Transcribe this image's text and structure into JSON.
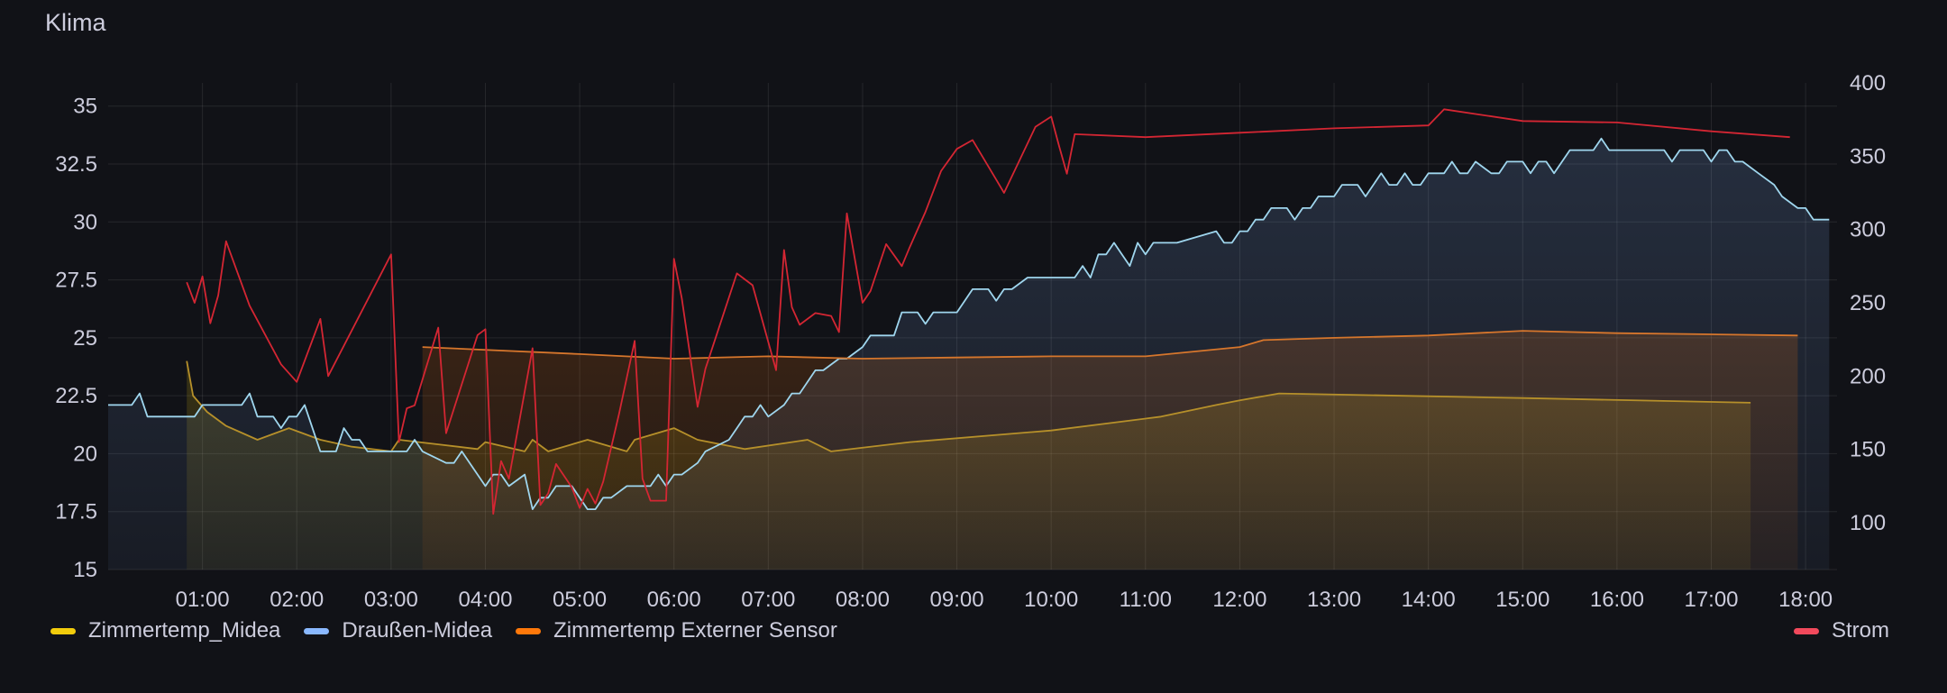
{
  "panel": {
    "title": "Klima"
  },
  "chart_data": {
    "type": "line",
    "x_axis": {
      "type": "time",
      "range": [
        "00:00",
        "18:20"
      ],
      "ticks": [
        "01:00",
        "02:00",
        "03:00",
        "04:00",
        "05:00",
        "06:00",
        "07:00",
        "08:00",
        "09:00",
        "10:00",
        "11:00",
        "12:00",
        "13:00",
        "14:00",
        "15:00",
        "16:00",
        "17:00",
        "18:00"
      ]
    },
    "y_left": {
      "ylim": [
        15,
        36
      ],
      "ticks": [
        15,
        17.5,
        20,
        22.5,
        25,
        27.5,
        30,
        32.5,
        35
      ],
      "tick_labels": [
        "15",
        "17.5",
        "20",
        "22.5",
        "25",
        "27.5",
        "30",
        "32.5",
        "35"
      ]
    },
    "y_right": {
      "ylim": [
        68,
        400
      ],
      "ticks": [
        100,
        150,
        200,
        250,
        300,
        350,
        400
      ],
      "tick_labels": [
        "100",
        "150",
        "200",
        "250",
        "300",
        "350",
        "400"
      ]
    },
    "grid": true,
    "series": [
      {
        "name": "Zimmertemp_Midea",
        "axis": "left",
        "color": "#F2CC0C",
        "stroke": "#b6902a",
        "fill": true,
        "points": [
          [
            "00:50",
            24
          ],
          [
            "00:54",
            22.5
          ],
          [
            "01:03",
            21.8
          ],
          [
            "01:15",
            21.2
          ],
          [
            "01:35",
            20.6
          ],
          [
            "01:55",
            21.1
          ],
          [
            "02:15",
            20.6
          ],
          [
            "02:35",
            20.3
          ],
          [
            "03:00",
            20.1
          ],
          [
            "03:05",
            20.6
          ],
          [
            "03:30",
            20.4
          ],
          [
            "03:55",
            20.2
          ],
          [
            "04:00",
            20.5
          ],
          [
            "04:25",
            20.1
          ],
          [
            "04:30",
            20.6
          ],
          [
            "04:40",
            20.1
          ],
          [
            "05:05",
            20.6
          ],
          [
            "05:30",
            20.1
          ],
          [
            "05:35",
            20.6
          ],
          [
            "06:00",
            21.1
          ],
          [
            "06:15",
            20.6
          ],
          [
            "06:45",
            20.2
          ],
          [
            "07:15",
            20.5
          ],
          [
            "07:25",
            20.6
          ],
          [
            "07:40",
            20.1
          ],
          [
            "08:30",
            20.5
          ],
          [
            "10:00",
            21
          ],
          [
            "11:10",
            21.6
          ],
          [
            "11:45",
            22.1
          ],
          [
            "12:00",
            22.3
          ],
          [
            "12:25",
            22.6
          ],
          [
            "15:00",
            22.4
          ],
          [
            "17:25",
            22.2
          ]
        ]
      },
      {
        "name": "Draußen-Midea",
        "axis": "left",
        "color": "#8AB8FF",
        "stroke": "#9fd6ee",
        "fill": true,
        "points": [
          [
            "00:00",
            22.1
          ],
          [
            "00:15",
            22.1
          ],
          [
            "00:20",
            22.6
          ],
          [
            "00:25",
            21.6
          ],
          [
            "00:55",
            21.6
          ],
          [
            "01:00",
            22.1
          ],
          [
            "01:25",
            22.1
          ],
          [
            "01:30",
            22.6
          ],
          [
            "01:35",
            21.6
          ],
          [
            "01:45",
            21.6
          ],
          [
            "01:50",
            21.1
          ],
          [
            "01:55",
            21.6
          ],
          [
            "02:00",
            21.6
          ],
          [
            "02:05",
            22.1
          ],
          [
            "02:15",
            20.1
          ],
          [
            "02:25",
            20.1
          ],
          [
            "02:30",
            21.1
          ],
          [
            "02:35",
            20.6
          ],
          [
            "02:40",
            20.6
          ],
          [
            "02:45",
            20.1
          ],
          [
            "03:05",
            20.1
          ],
          [
            "03:10",
            20.1
          ],
          [
            "03:15",
            20.6
          ],
          [
            "03:20",
            20.1
          ],
          [
            "03:35",
            19.6
          ],
          [
            "03:40",
            19.6
          ],
          [
            "03:45",
            20.1
          ],
          [
            "04:00",
            18.6
          ],
          [
            "04:05",
            19.1
          ],
          [
            "04:10",
            19.1
          ],
          [
            "04:15",
            18.6
          ],
          [
            "04:25",
            19.1
          ],
          [
            "04:30",
            17.6
          ],
          [
            "04:35",
            18.1
          ],
          [
            "04:40",
            18.1
          ],
          [
            "04:45",
            18.6
          ],
          [
            "04:55",
            18.6
          ],
          [
            "05:00",
            18.1
          ],
          [
            "05:05",
            17.6
          ],
          [
            "05:10",
            17.6
          ],
          [
            "05:15",
            18.1
          ],
          [
            "05:20",
            18.1
          ],
          [
            "05:30",
            18.6
          ],
          [
            "05:35",
            18.6
          ],
          [
            "05:45",
            18.6
          ],
          [
            "05:50",
            19.1
          ],
          [
            "05:55",
            18.6
          ],
          [
            "06:00",
            19.1
          ],
          [
            "06:05",
            19.1
          ],
          [
            "06:15",
            19.6
          ],
          [
            "06:20",
            20.1
          ],
          [
            "06:35",
            20.6
          ],
          [
            "06:40",
            21.1
          ],
          [
            "06:45",
            21.6
          ],
          [
            "06:50",
            21.6
          ],
          [
            "06:55",
            22.1
          ],
          [
            "07:00",
            21.6
          ],
          [
            "07:10",
            22.1
          ],
          [
            "07:15",
            22.6
          ],
          [
            "07:20",
            22.6
          ],
          [
            "07:25",
            23.1
          ],
          [
            "07:30",
            23.6
          ],
          [
            "07:35",
            23.6
          ],
          [
            "07:45",
            24.1
          ],
          [
            "07:50",
            24.1
          ],
          [
            "08:00",
            24.6
          ],
          [
            "08:05",
            25.1
          ],
          [
            "08:20",
            25.1
          ],
          [
            "08:25",
            26.1
          ],
          [
            "08:35",
            26.1
          ],
          [
            "08:40",
            25.6
          ],
          [
            "08:45",
            26.1
          ],
          [
            "09:00",
            26.1
          ],
          [
            "09:05",
            26.6
          ],
          [
            "09:10",
            27.1
          ],
          [
            "09:20",
            27.1
          ],
          [
            "09:25",
            26.6
          ],
          [
            "09:30",
            27.1
          ],
          [
            "09:35",
            27.1
          ],
          [
            "09:45",
            27.6
          ],
          [
            "09:55",
            27.6
          ],
          [
            "10:15",
            27.6
          ],
          [
            "10:20",
            28.1
          ],
          [
            "10:25",
            27.6
          ],
          [
            "10:30",
            28.6
          ],
          [
            "10:35",
            28.6
          ],
          [
            "10:40",
            29.1
          ],
          [
            "10:45",
            28.6
          ],
          [
            "10:50",
            28.1
          ],
          [
            "10:55",
            29.1
          ],
          [
            "11:00",
            28.6
          ],
          [
            "11:05",
            29.1
          ],
          [
            "11:15",
            29.1
          ],
          [
            "11:20",
            29.1
          ],
          [
            "11:45",
            29.6
          ],
          [
            "11:50",
            29.1
          ],
          [
            "11:55",
            29.1
          ],
          [
            "12:00",
            29.6
          ],
          [
            "12:05",
            29.6
          ],
          [
            "12:10",
            30.1
          ],
          [
            "12:15",
            30.1
          ],
          [
            "12:20",
            30.6
          ],
          [
            "12:30",
            30.6
          ],
          [
            "12:35",
            30.1
          ],
          [
            "12:40",
            30.6
          ],
          [
            "12:45",
            30.6
          ],
          [
            "12:50",
            31.1
          ],
          [
            "13:00",
            31.1
          ],
          [
            "13:05",
            31.6
          ],
          [
            "13:15",
            31.6
          ],
          [
            "13:20",
            31.1
          ],
          [
            "13:25",
            31.6
          ],
          [
            "13:30",
            32.1
          ],
          [
            "13:35",
            31.6
          ],
          [
            "13:40",
            31.6
          ],
          [
            "13:45",
            32.1
          ],
          [
            "13:50",
            31.6
          ],
          [
            "13:55",
            31.6
          ],
          [
            "14:00",
            32.1
          ],
          [
            "14:10",
            32.1
          ],
          [
            "14:15",
            32.6
          ],
          [
            "14:20",
            32.1
          ],
          [
            "14:25",
            32.1
          ],
          [
            "14:30",
            32.6
          ],
          [
            "14:40",
            32.1
          ],
          [
            "14:45",
            32.1
          ],
          [
            "14:50",
            32.6
          ],
          [
            "15:00",
            32.6
          ],
          [
            "15:05",
            32.1
          ],
          [
            "15:10",
            32.6
          ],
          [
            "15:15",
            32.6
          ],
          [
            "15:20",
            32.1
          ],
          [
            "15:25",
            32.6
          ],
          [
            "15:30",
            33.1
          ],
          [
            "15:45",
            33.1
          ],
          [
            "15:50",
            33.6
          ],
          [
            "15:55",
            33.1
          ],
          [
            "16:30",
            33.1
          ],
          [
            "16:35",
            32.6
          ],
          [
            "16:40",
            33.1
          ],
          [
            "16:55",
            33.1
          ],
          [
            "17:00",
            32.6
          ],
          [
            "17:05",
            33.1
          ],
          [
            "17:10",
            33.1
          ],
          [
            "17:15",
            32.6
          ],
          [
            "17:20",
            32.6
          ],
          [
            "17:30",
            32.1
          ],
          [
            "17:40",
            31.6
          ],
          [
            "17:45",
            31.1
          ],
          [
            "17:55",
            30.6
          ],
          [
            "18:00",
            30.6
          ],
          [
            "18:05",
            30.1
          ],
          [
            "18:15",
            30.1
          ]
        ]
      },
      {
        "name": "Zimmertemp Externer Sensor",
        "axis": "left",
        "color": "#FF780A",
        "stroke": "#d6762c",
        "fill": true,
        "points": [
          [
            "03:20",
            24.6
          ],
          [
            "05:00",
            24.3
          ],
          [
            "06:00",
            24.1
          ],
          [
            "07:00",
            24.2
          ],
          [
            "08:00",
            24.1
          ],
          [
            "09:00",
            24.15
          ],
          [
            "10:00",
            24.2
          ],
          [
            "11:00",
            24.2
          ],
          [
            "12:00",
            24.6
          ],
          [
            "12:15",
            24.9
          ],
          [
            "13:00",
            25
          ],
          [
            "14:00",
            25.1
          ],
          [
            "15:00",
            25.3
          ],
          [
            "16:00",
            25.2
          ],
          [
            "17:00",
            25.15
          ],
          [
            "17:55",
            25.1
          ]
        ]
      },
      {
        "name": "Strom",
        "axis": "right",
        "color": "#F2495C",
        "stroke": "#d42633",
        "fill": false,
        "points": [
          [
            "00:50",
            264
          ],
          [
            "00:55",
            250
          ],
          [
            "01:00",
            268
          ],
          [
            "01:05",
            236
          ],
          [
            "01:10",
            255
          ],
          [
            "01:15",
            292
          ],
          [
            "01:30",
            248
          ],
          [
            "01:50",
            208
          ],
          [
            "02:00",
            196
          ],
          [
            "02:15",
            239
          ],
          [
            "02:20",
            200
          ],
          [
            "03:00",
            283
          ],
          [
            "03:05",
            155
          ],
          [
            "03:10",
            178
          ],
          [
            "03:15",
            180
          ],
          [
            "03:30",
            233
          ],
          [
            "03:35",
            161
          ],
          [
            "03:55",
            228
          ],
          [
            "04:00",
            232
          ],
          [
            "04:05",
            106
          ],
          [
            "04:10",
            142
          ],
          [
            "04:15",
            130
          ],
          [
            "04:30",
            219
          ],
          [
            "04:35",
            112
          ],
          [
            "04:40",
            120
          ],
          [
            "04:45",
            140
          ],
          [
            "04:55",
            124
          ],
          [
            "05:00",
            110
          ],
          [
            "05:05",
            123
          ],
          [
            "05:10",
            113
          ],
          [
            "05:15",
            128
          ],
          [
            "05:25",
            174
          ],
          [
            "05:35",
            224
          ],
          [
            "05:40",
            130
          ],
          [
            "05:45",
            115
          ],
          [
            "05:55",
            115
          ],
          [
            "06:00",
            280
          ],
          [
            "06:05",
            253
          ],
          [
            "06:15",
            179
          ],
          [
            "06:20",
            205
          ],
          [
            "06:40",
            270
          ],
          [
            "06:50",
            262
          ],
          [
            "07:05",
            204
          ],
          [
            "07:10",
            286
          ],
          [
            "07:15",
            247
          ],
          [
            "07:20",
            235
          ],
          [
            "07:30",
            243
          ],
          [
            "07:40",
            241
          ],
          [
            "07:45",
            230
          ],
          [
            "07:50",
            311
          ],
          [
            "08:00",
            250
          ],
          [
            "08:05",
            258
          ],
          [
            "08:15",
            290
          ],
          [
            "08:25",
            275
          ],
          [
            "08:30",
            288
          ],
          [
            "08:40",
            312
          ],
          [
            "08:50",
            340
          ],
          [
            "09:00",
            355
          ],
          [
            "09:10",
            361
          ],
          [
            "09:25",
            334
          ],
          [
            "09:30",
            325
          ],
          [
            "09:50",
            370
          ],
          [
            "10:00",
            377
          ],
          [
            "10:05",
            357
          ],
          [
            "10:10",
            338
          ],
          [
            "10:15",
            365
          ],
          [
            "11:00",
            363
          ],
          [
            "12:00",
            366
          ],
          [
            "13:00",
            369
          ],
          [
            "14:00",
            371
          ],
          [
            "14:10",
            382
          ],
          [
            "15:00",
            374
          ],
          [
            "16:00",
            373
          ],
          [
            "17:00",
            367
          ],
          [
            "17:50",
            363
          ]
        ]
      }
    ]
  },
  "legend": {
    "left": [
      {
        "label": "Zimmertemp_Midea",
        "color": "#F2CC0C"
      },
      {
        "label": "Draußen-Midea",
        "color": "#8AB8FF"
      },
      {
        "label": "Zimmertemp Externer Sensor",
        "color": "#FF780A"
      }
    ],
    "right": [
      {
        "label": "Strom",
        "color": "#F2495C"
      }
    ]
  }
}
